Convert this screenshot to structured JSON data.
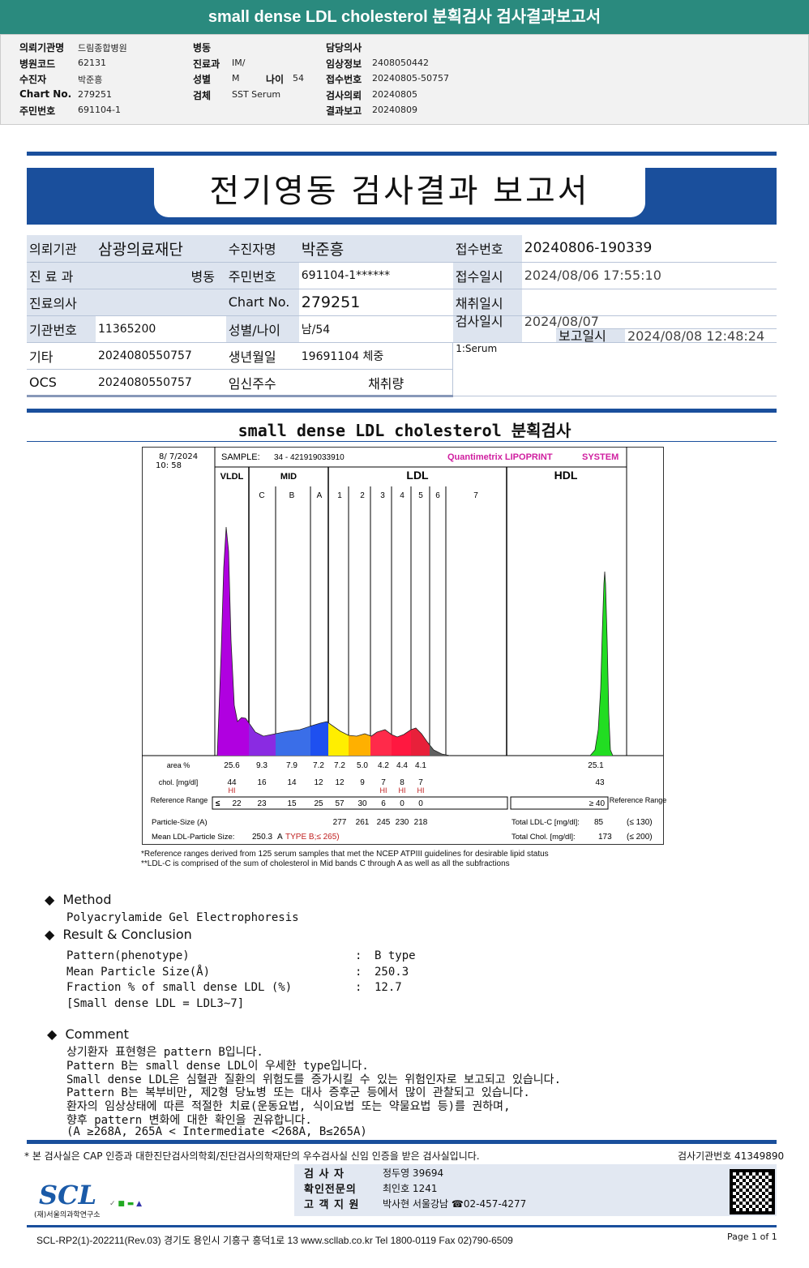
{
  "top_title": "small dense LDL cholesterol 분획검사 검사결과보고서",
  "header": {
    "col1": [
      [
        "의뢰기관명",
        "드림종합병원"
      ],
      [
        "병원코드",
        "62131"
      ],
      [
        "수진자",
        "박준흥"
      ],
      [
        "Chart No.",
        "279251"
      ],
      [
        "주민번호",
        "691104-1"
      ]
    ],
    "col2": [
      [
        "병동",
        ""
      ],
      [
        "진료과",
        "IM/"
      ],
      [
        "성별",
        "M"
      ],
      [
        "검체",
        "SST Serum"
      ]
    ],
    "age_label": "나이",
    "age": "54",
    "col3": [
      [
        "담당의사",
        ""
      ],
      [
        "임상정보",
        "2408050442"
      ],
      [
        "접수번호",
        "20240805-50757"
      ],
      [
        "검사의뢰",
        "20240805"
      ],
      [
        "결과보고",
        "20240809"
      ]
    ]
  },
  "report_title": "전기영동 검사결과 보고서",
  "info": {
    "r1": [
      "의뢰기관",
      "삼광의료재단",
      "수진자명",
      "박준흥",
      "접수번호",
      "20240806-190339"
    ],
    "r2": [
      "진 료 과",
      "병동",
      "주민번호",
      "691104-1******",
      "접수일시",
      "2024/08/06 17:55:10"
    ],
    "r3": [
      "진료의사",
      "",
      "Chart No.",
      "279251",
      "채취일시",
      ""
    ],
    "r4": [
      "기관번호",
      "11365200",
      "성별/나이",
      "남/54",
      "검사일시",
      "2024/08/07"
    ],
    "r5": [
      "보고일시",
      "2024/08/08 12:48:24"
    ],
    "r6": [
      "기타",
      "2024080550757",
      "생년월일",
      "19691104 체중",
      "1:Serum"
    ],
    "r7": [
      "OCS",
      "2024080550757",
      "임신주수",
      "채취량"
    ]
  },
  "section_title": "small dense LDL cholesterol 분획검사",
  "chart": {
    "datetime": "8/ 7/2024\n10: 58",
    "sample_label": "SAMPLE:",
    "sample": "34 - 421919033910",
    "brand": "Quantimetrix LIPOPRINT",
    "brand2": "SYSTEM",
    "groups": [
      "VLDL",
      "MID",
      "LDL",
      "HDL"
    ],
    "bands": [
      "C",
      "B",
      "A",
      "1",
      "2",
      "3",
      "4",
      "5",
      "6",
      "7"
    ],
    "row_labels": {
      "area": "area %",
      "chol": "chol. [mg/dl]",
      "ref": "Reference Range",
      "ref2": "Reference Range",
      "size": "Particle-Size (A)",
      "mean": "Mean LDL-Particle Size:"
    },
    "area": [
      "25.6",
      "9.3",
      "7.9",
      "7.2",
      "7.2",
      "5.0",
      "4.2",
      "4.4",
      "4.1"
    ],
    "area_hdl": "25.1",
    "chol": [
      "44",
      "16",
      "14",
      "12",
      "12",
      "9",
      "7",
      "8",
      "7"
    ],
    "chol_hdl": "43",
    "flags": [
      "HI",
      "",
      "",
      "",
      "",
      "",
      "HI",
      "HI",
      "HI"
    ],
    "ref_prefix": "≤",
    "ref": [
      "22",
      "23",
      "15",
      "25",
      "57",
      "30",
      "6",
      "0",
      "0"
    ],
    "ref_hdl": "≥  40",
    "size": [
      "277",
      "261",
      "245",
      "230",
      "218"
    ],
    "mean_size": "250.3",
    "mean_type": "A",
    "mean_type2": "TYPE B;≤ 265)",
    "total_ldl_label": "Total LDL-C [mg/dl]:",
    "total_ldl": "85",
    "total_ldl_ref": "(≤ 130)",
    "total_chol_label": "Total Chol. [mg/dl]:",
    "total_chol": "173",
    "total_chol_ref": "(≤ 200)",
    "colors": {
      "vldl": "#b000e0",
      "c": "#8a2be2",
      "b": "#3a6ee8",
      "a": "#1e50f0",
      "1": "#ffee00",
      "2": "#ffb000",
      "3": "#ff2a4a",
      "4": "#ff1840",
      "5": "#e8203a",
      "6": "#606060",
      "hdl": "#22dd22"
    },
    "note1": "*Reference ranges derived from 125 serum samples that met the NCEP ATPIII guidelines for desirable lipid status",
    "note2": "**LDL-C is comprised of the sum of cholesterol in Mid bands C through A as well as all the subfractions"
  },
  "chart_data": {
    "type": "bar",
    "categories": [
      "VLDL",
      "MID C",
      "MID B",
      "MID A",
      "LDL1",
      "LDL2",
      "LDL3",
      "LDL4",
      "LDL5",
      "HDL"
    ],
    "series": [
      {
        "name": "area %",
        "values": [
          25.6,
          9.3,
          7.9,
          7.2,
          7.2,
          5.0,
          4.2,
          4.4,
          4.1,
          25.1
        ]
      },
      {
        "name": "chol. [mg/dl]",
        "values": [
          44,
          16,
          14,
          12,
          12,
          9,
          7,
          8,
          7,
          43
        ]
      }
    ]
  },
  "method": {
    "title": "Method",
    "text": "Polyacrylamide Gel Electrophoresis"
  },
  "result": {
    "title": "Result & Conclusion",
    "rows": [
      [
        "Pattern(phenotype)",
        ":",
        "B type"
      ],
      [
        "Mean Particle Size(Å)",
        ":",
        "250.3"
      ],
      [
        "Fraction % of small dense LDL (%)",
        ":",
        "12.7"
      ]
    ],
    "note": "[Small dense LDL = LDL3~7]"
  },
  "comment": {
    "title": "Comment",
    "lines": [
      "상기환자 표현형은 pattern B입니다.",
      "Pattern B는 small dense LDL이 우세한 type입니다.",
      "Small dense LDL은 심혈관 질환의 위험도를 증가시킬 수 있는 위험인자로 보고되고 있습니다.",
      "Pattern B는 복부비만, 제2형 당뇨병 또는 대사 증후군 등에서 많이 관찰되고 있습니다.",
      "환자의 임상상태에 따른 적절한 치료(운동요법, 식이요법 또는 약물요법 등)를 권하며,",
      "향후 pattern 변화에 대한 확인을 권유합니다.",
      "(A ≥268A, 265A < Intermediate <268A, B≤265A)"
    ]
  },
  "footer": {
    "cert": "* 본 검사실은 CAP 인증과 대한진단검사의학회/진단검사의학재단의 우수검사실 신임 인증을 받은 검사실입니다.",
    "inst_no": "검사기관번호 41349890",
    "logo": "SCL",
    "logo_sub": "(재)서울의과학연구소",
    "staff": [
      [
        "검 사 자",
        "정두영 39694"
      ],
      [
        "확인전문의",
        "최인호 1241"
      ],
      [
        "고 객 지 원",
        "박사현 서울강남 ☎02-457-4277"
      ]
    ],
    "address": "SCL-RP2(1)-202211(Rev.03)  경기도 용인시 기흥구 흥덕1로 13  www.scllab.co.kr  Tel 1800-0119   Fax 02)790-6509",
    "page": "Page 1 of 1"
  }
}
